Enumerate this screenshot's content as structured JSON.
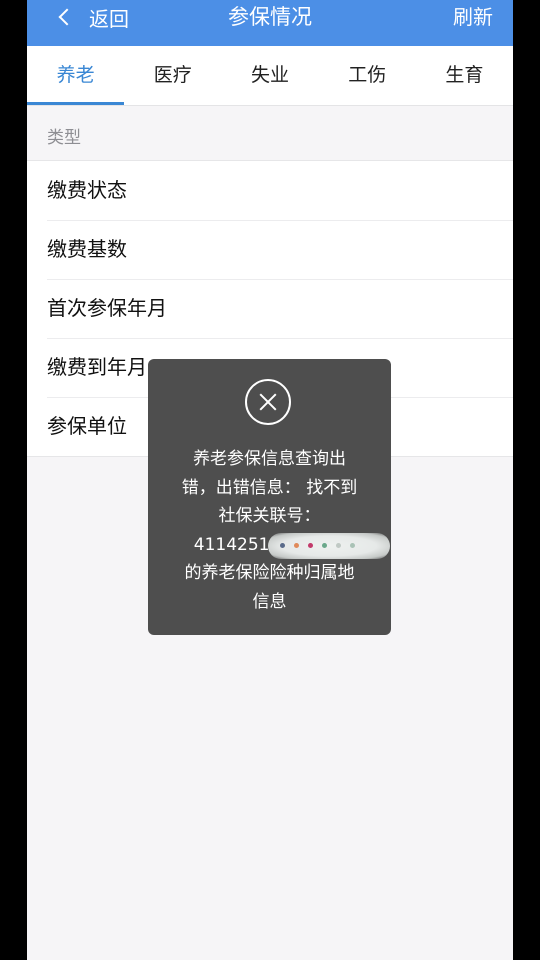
{
  "header": {
    "back_label": "返回",
    "title": "参保情况",
    "refresh_label": "刷新"
  },
  "tabs": [
    {
      "label": "养老",
      "active": true
    },
    {
      "label": "医疗",
      "active": false
    },
    {
      "label": "失业",
      "active": false
    },
    {
      "label": "工伤",
      "active": false
    },
    {
      "label": "生育",
      "active": false
    }
  ],
  "section_label": "类型",
  "rows": [
    {
      "label": "缴费状态"
    },
    {
      "label": "缴费基数"
    },
    {
      "label": "首次参保年月"
    },
    {
      "label": "缴费到年月"
    },
    {
      "label": "参保单位"
    }
  ],
  "toast": {
    "icon": "close-circle-icon",
    "line1": "养老参保信息查询出",
    "line2": "错，出错信息： 找不到",
    "line3": "社保关联号：",
    "line4_number": "4114251",
    "line5": "的养老保险险种归属地",
    "line6": "信息"
  },
  "colors": {
    "header_bg": "#4c8fe6",
    "tab_active": "#3a87d4",
    "toast_bg": "#484848",
    "page_bg": "#f6f5f7"
  }
}
